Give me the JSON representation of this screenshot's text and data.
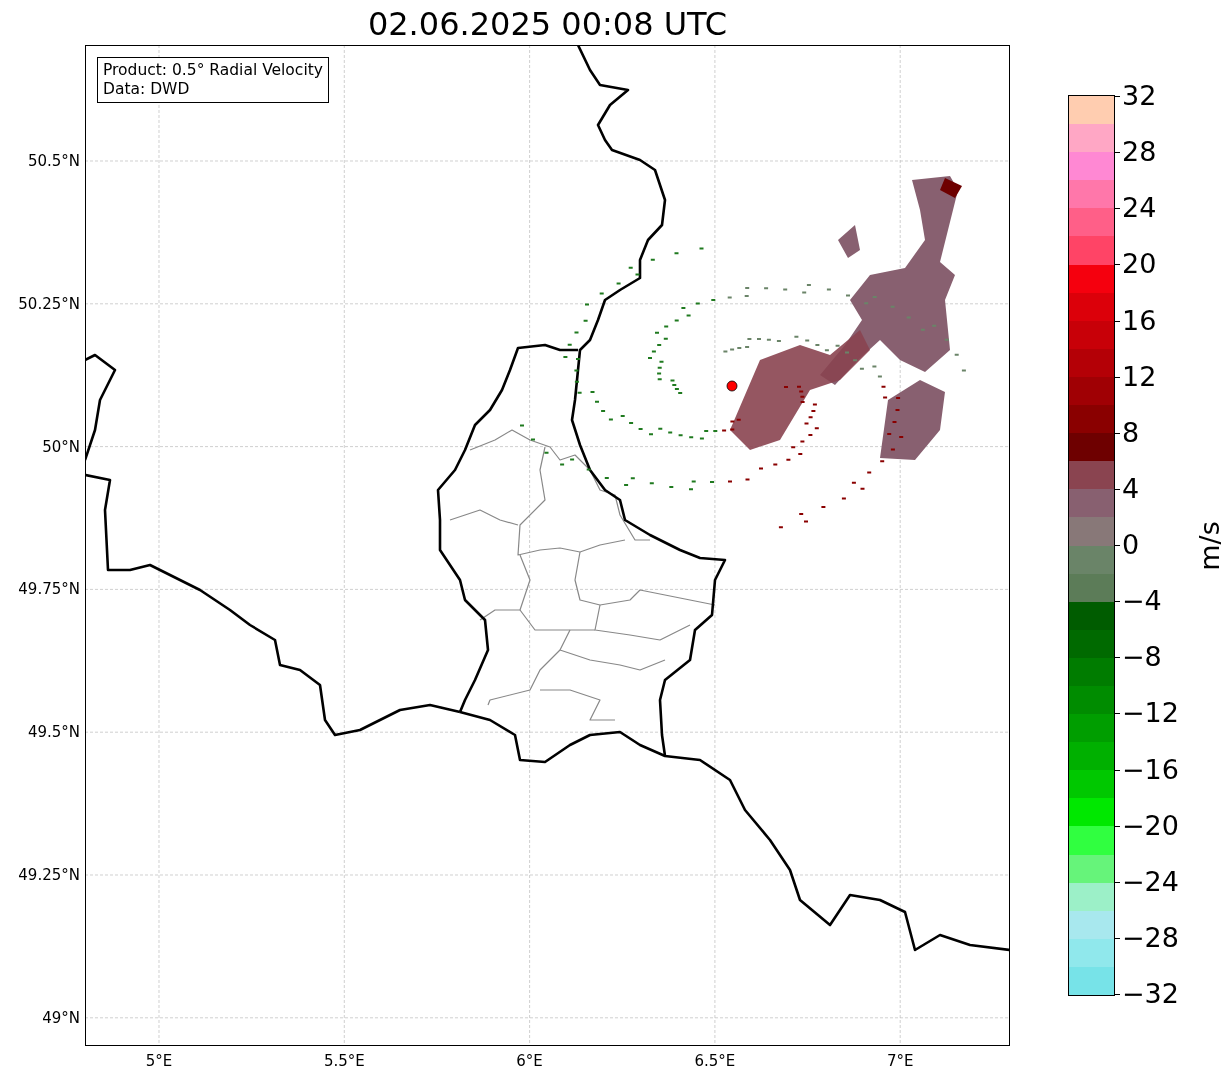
{
  "title": "02.06.2025 00:08 UTC",
  "info_box": [
    "Product: 0.5° Radial Velocity",
    "Data: DWD"
  ],
  "y_ticks": [
    "50.5°N",
    "50.25°N",
    "50°N",
    "49.75°N",
    "49.5°N",
    "49.25°N",
    "49°N"
  ],
  "x_ticks": [
    "5°E",
    "5.5°E",
    "6°E",
    "6.5°E",
    "7°E"
  ],
  "colorbar": {
    "label": "m/s",
    "ticks": [
      "32",
      "28",
      "24",
      "20",
      "16",
      "12",
      "8",
      "4",
      "0",
      "−4",
      "−8",
      "−12",
      "−16",
      "−20",
      "−24",
      "−28",
      "−32"
    ],
    "bins": [
      {
        "color": "#ffcdb0"
      },
      {
        "color": "#ffa7c5"
      },
      {
        "color": "#ff88d3"
      },
      {
        "color": "#ff77aa"
      },
      {
        "color": "#ff5f88"
      },
      {
        "color": "#ff4466"
      },
      {
        "color": "#f5000e"
      },
      {
        "color": "#dc000a"
      },
      {
        "color": "#c80008"
      },
      {
        "color": "#b40006"
      },
      {
        "color": "#a00004"
      },
      {
        "color": "#8a0000"
      },
      {
        "color": "#6e0000"
      },
      {
        "color": "#8a4450"
      },
      {
        "color": "#886070"
      },
      {
        "color": "#887878"
      },
      {
        "color": "#6a8468"
      },
      {
        "color": "#5c7c58"
      },
      {
        "color": "#005c00"
      },
      {
        "color": "#006a00"
      },
      {
        "color": "#007c00"
      },
      {
        "color": "#008c00"
      },
      {
        "color": "#009e00"
      },
      {
        "color": "#00b000"
      },
      {
        "color": "#00c800"
      },
      {
        "color": "#00e800"
      },
      {
        "color": "#30ff40"
      },
      {
        "color": "#66f47a"
      },
      {
        "color": "#9cf0c8"
      },
      {
        "color": "#a8e8ee"
      },
      {
        "color": "#90e8ec"
      },
      {
        "color": "#77e3e8"
      }
    ]
  }
}
